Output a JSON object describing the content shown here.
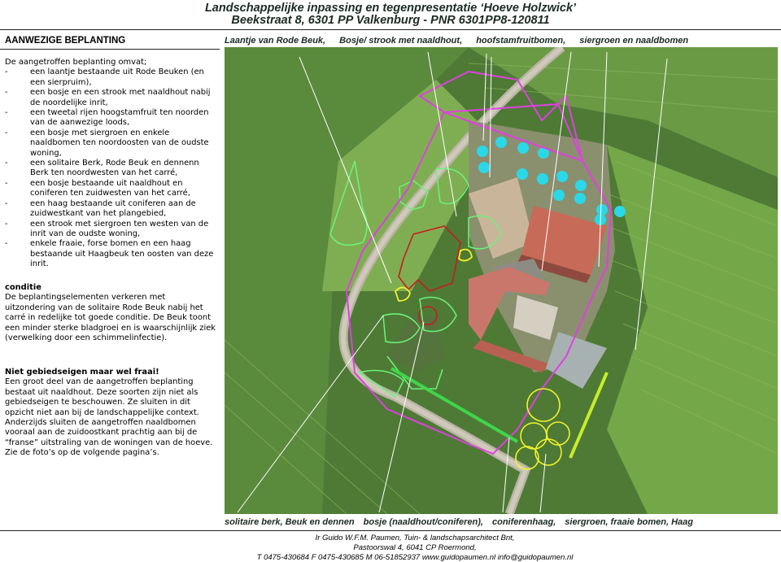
{
  "header": {
    "line1": "Landschappelijke inpassing en tegenpresentatie ‘Hoeve Holzwick’",
    "line2": "Beekstraat 8, 6301 PP Valkenburg -  PNR 6301PP8-120811"
  },
  "section_title": "AANWEZIGE BEPLANTING",
  "caption_top": [
    "Laantje van Rode Beuk,",
    "Bosje/ strook met naaldhout,",
    "hoofstamfruitbomen,",
    "siergroen en naaldbomen"
  ],
  "intro": "De aangetroffen beplanting omvat;",
  "planting_items": [
    "een laantje bestaande uit Rode Beuken (en een sierpruim),",
    "een bosje en een strook met naaldhout nabij de noordelijke inrit,",
    "een tweetal rijen hoogstamfruit ten noorden van de aanwezige loods,",
    "een bosje met siergroen en enkele naaldbomen ten noordoosten van de oudste woning,",
    "een solitaire Berk, Rode Beuk en dennenn Berk ten noordwesten van het carré,",
    "een bosje bestaande uit naaldhout en coniferen ten zuidwesten van het carré,",
    "een haag bestaande uit coniferen aan de zuidwestkant van het plangebied,",
    "een strook met siergroen ten westen van de inrit van de oudste woning,",
    "enkele fraaie, forse bomen en een haag bestaande uit Haagbeuk ten oosten van deze inrit."
  ],
  "condition": {
    "title": "conditie",
    "text": "De beplantingselementen verkeren met uitzondering van de solitaire Rode Beuk nabij het carré in redelijke tot goede conditie. De Beuk toont een minder sterke bladgroei en is waarschijnlijk ziek (verwelking door een schimmelinfectie)."
  },
  "warning": {
    "title": "Niet gebiedseigen maar wel fraai!",
    "text": "Een groot deel van de aangetroffen beplanting bestaat uit naaldhout. Deze soorten zijn niet als gebiedseigen te beschouwen. Ze sluiten in dit opzicht niet aan bij de landschappelijke context. Anderzijds sluiten de aangetroffen naaldbomen vooraal aan de zuidoostkant prachtig aan bij de “franse” uitstraling van de woningen van de hoeve. Zie de foto’s op de volgende pagina’s."
  },
  "caption_bottom": [
    "solitaire berk, Beuk en dennen",
    "bosje (naaldhout/coniferen),",
    "coniferenhaag,",
    "siergroen, fraaie bomen, Haag"
  ],
  "footer": {
    "line1": "Ir Guido W.F.M. Paumen,  Tuin- & landschapsarchitect  Bnt,",
    "line2": "Pastoorswal 4, 6041 CP Roermond,",
    "line3": "T 0475-430684 F 0475-430685 M 06-51852937   www.guidopaumen.nl  info@guidopaumen.nl"
  },
  "colors": {
    "boundary": "#e040e0",
    "conifer": "#6cf27a",
    "fruit_trees": "#2ad8e8",
    "red_beech": "#c41e1e",
    "yellow_marker": "#f2f22a",
    "hedge": "#9bf03a",
    "roof": "#c86a58"
  }
}
